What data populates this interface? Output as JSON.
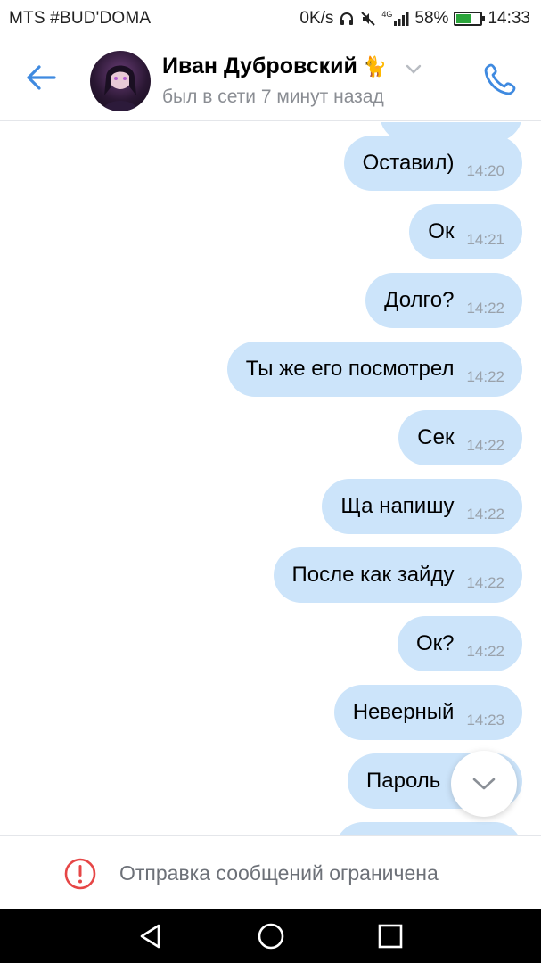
{
  "status_bar": {
    "carrier": "MTS #BUD'DOMA",
    "net_speed": "0K/s",
    "network": "4G",
    "battery": "58%",
    "battery_level": 0.58,
    "time": "14:33"
  },
  "header": {
    "back_icon": "arrow-left-icon",
    "contact_name": "Иван Дубровский",
    "name_emoji": "🐈",
    "status": "был в сети 7 минут назад",
    "call_icon": "phone-icon"
  },
  "messages": [
    {
      "text": "Оставил)",
      "time": "14:20"
    },
    {
      "text": "Ок",
      "time": "14:21"
    },
    {
      "text": "Долго?",
      "time": "14:22"
    },
    {
      "text": "Ты же его посмотрел",
      "time": "14:22"
    },
    {
      "text": "Сек",
      "time": "14:22"
    },
    {
      "text": "Ща напишу",
      "time": "14:22"
    },
    {
      "text": "После как зайду",
      "time": "14:22"
    },
    {
      "text": "Ок?",
      "time": "14:22"
    },
    {
      "text": "Неверный",
      "time": "14:23"
    },
    {
      "text": "Пароль",
      "time": ""
    }
  ],
  "restriction": {
    "text": "Отправка сообщений ограничена",
    "icon": "exclamation-circle-icon",
    "color": "#e64646"
  },
  "colors": {
    "accent": "#3f8ae0",
    "bubble": "#cce4fa"
  }
}
